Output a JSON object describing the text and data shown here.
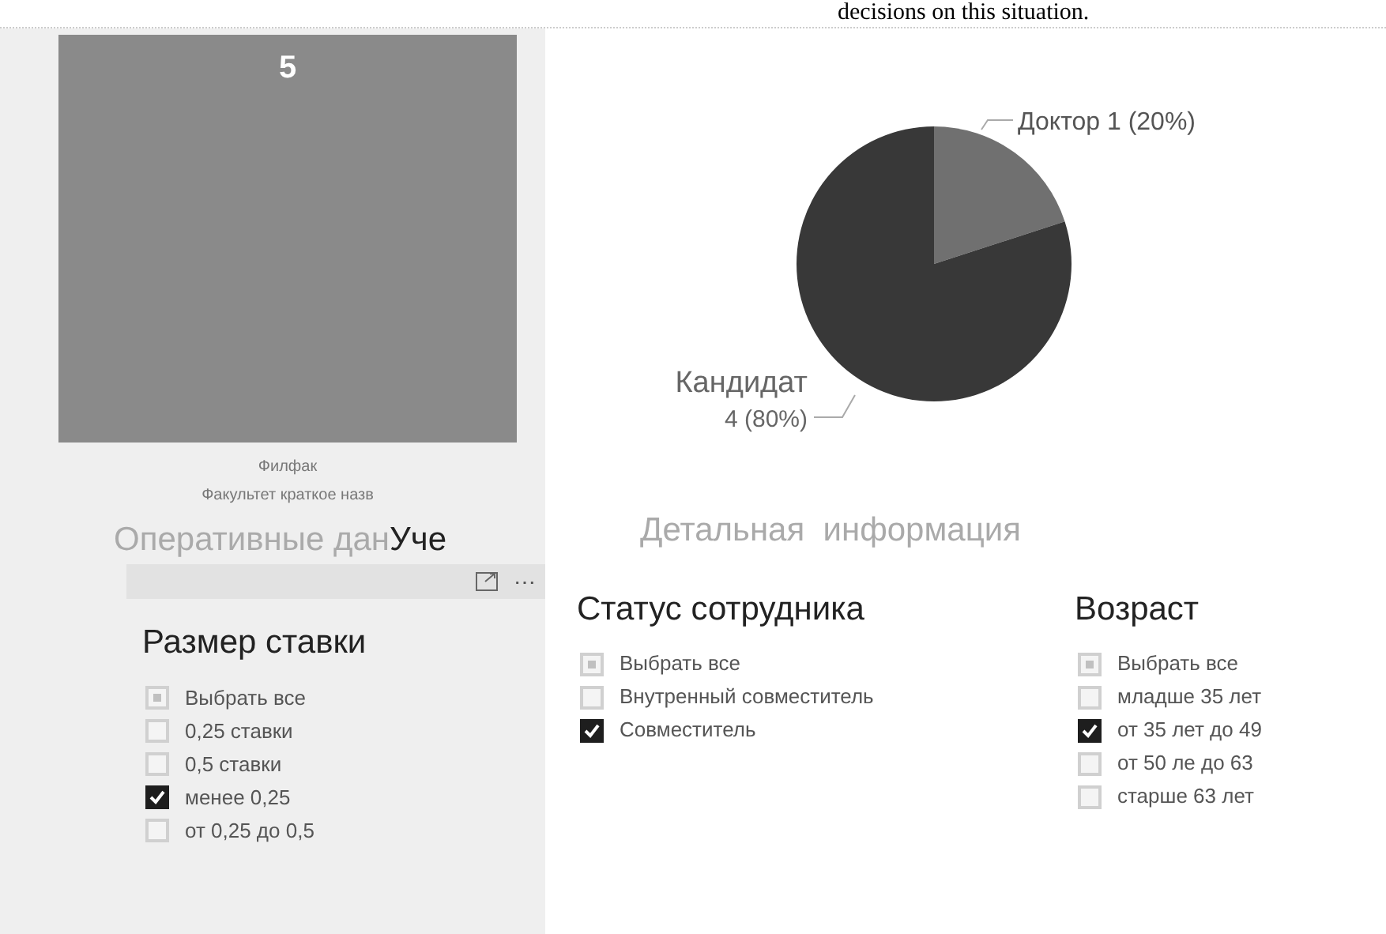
{
  "caption": "decisions on this situation.",
  "card": {
    "value": "5",
    "labels": [
      "Филфак",
      "Факультет краткое назв"
    ]
  },
  "section_title": "Оперативные дан",
  "overlap_title": "Уче",
  "visual_header": {
    "more": "⋯"
  },
  "rate_slicer": {
    "title": "Размер ставки",
    "items": [
      {
        "kind": "select_all",
        "label": "Выбрать все",
        "checked": false
      },
      {
        "kind": "option",
        "label": "0,25 ставки",
        "checked": false
      },
      {
        "kind": "option",
        "label": "0,5 ставки",
        "checked": false
      },
      {
        "kind": "option",
        "label": "менее 0,25",
        "checked": true
      },
      {
        "kind": "option",
        "label": "от 0,25 до 0,5",
        "checked": false
      }
    ]
  },
  "pie": {
    "chart_data": {
      "type": "pie",
      "categories": [
        "Доктор",
        "Кандидат"
      ],
      "values": [
        1,
        4
      ],
      "colors": [
        "#707070",
        "#383838"
      ],
      "value_labels": [
        "1 (20%)",
        "4 (80%)"
      ]
    }
  },
  "detail_title": "Детальная  информация",
  "slicers": [
    {
      "title": "Статус сотрудника",
      "items": [
        {
          "kind": "select_all",
          "label": "Выбрать все",
          "checked": false
        },
        {
          "kind": "option",
          "label": "Внутренный совместитель",
          "checked": false
        },
        {
          "kind": "option",
          "label": "Совместитель",
          "checked": true
        }
      ]
    },
    {
      "title": "Возраст",
      "items": [
        {
          "kind": "select_all",
          "label": "Выбрать все",
          "checked": false
        },
        {
          "kind": "option",
          "label": "младше 35 лет",
          "checked": false
        },
        {
          "kind": "option",
          "label": "от 35 лет до 49",
          "checked": true
        },
        {
          "kind": "option",
          "label": "от 50 ле до 63",
          "checked": false
        },
        {
          "kind": "option",
          "label": "старше 63 лет",
          "checked": false
        }
      ]
    }
  ]
}
